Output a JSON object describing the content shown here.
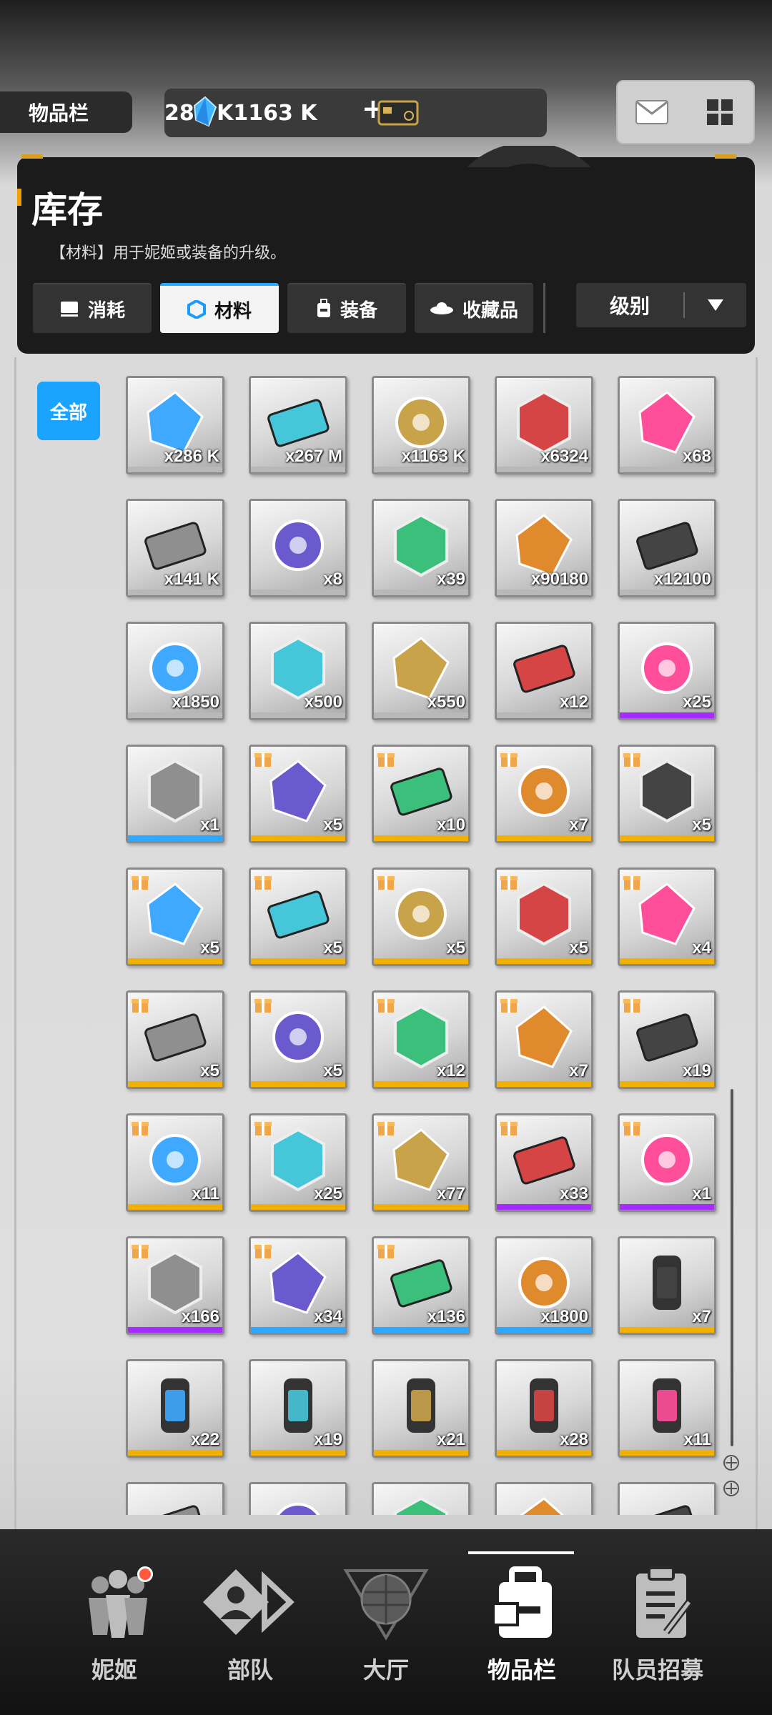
{
  "header": {
    "page_tag": "物品栏",
    "currency": {
      "gems": "286 K",
      "gems_icon": "blue-gem-icon",
      "cards": "1163 K",
      "cards_icon": "credit-card-icon"
    },
    "icons": [
      "mail-icon",
      "grid-menu-icon"
    ]
  },
  "panel": {
    "title": "库存",
    "subtitle": "【材料】用于妮姬或装备的升级。",
    "tabs": [
      {
        "label": "消耗",
        "icon": "consumable-icon"
      },
      {
        "label": "材料",
        "icon": "material-hex-icon",
        "active": true
      },
      {
        "label": "装备",
        "icon": "backpack-icon"
      },
      {
        "label": "收藏品",
        "icon": "ufo-collectible-icon"
      }
    ],
    "sort": {
      "label": "级别"
    }
  },
  "filter": {
    "all_label": "全部"
  },
  "rarity_colors": {
    "gray": "#b8b8b8",
    "blue": "#2ea9ff",
    "purple": "#a42cff",
    "gold": "#f2b000"
  },
  "items": [
    {
      "name": "blue-crystal",
      "count": "x286 K",
      "rarity": "gray",
      "gift": false
    },
    {
      "name": "usb-drive",
      "count": "x267 M",
      "rarity": "gray",
      "gift": false
    },
    {
      "name": "credit-card",
      "count": "x1163 K",
      "rarity": "gray",
      "gift": false
    },
    {
      "name": "core-orb",
      "count": "x6324",
      "rarity": "gray",
      "gift": false
    },
    {
      "name": "pink-heart-gem",
      "count": "x68",
      "rarity": "gray",
      "gift": false
    },
    {
      "name": "hex-ticket",
      "count": "x141 K",
      "rarity": "gray",
      "gift": false
    },
    {
      "name": "idol-card",
      "count": "x8",
      "rarity": "gray",
      "gift": false
    },
    {
      "name": "hologram-card",
      "count": "x39",
      "rarity": "gray",
      "gift": false
    },
    {
      "name": "red-sphere",
      "count": "x90180",
      "rarity": "gray",
      "gift": false
    },
    {
      "name": "dna-hex",
      "count": "x12100",
      "rarity": "gray",
      "gift": false
    },
    {
      "name": "red-emblem-box",
      "count": "x1850",
      "rarity": "gray",
      "gift": false
    },
    {
      "name": "silver-wing-ticket",
      "count": "x500",
      "rarity": "gray",
      "gift": false
    },
    {
      "name": "gold-wing-ticket",
      "count": "x550",
      "rarity": "gray",
      "gift": false
    },
    {
      "name": "id-badge",
      "count": "x12",
      "rarity": "gray",
      "gift": false
    },
    {
      "name": "black-chest-plate",
      "count": "x25",
      "rarity": "purple",
      "gift": false
    },
    {
      "name": "black-module",
      "count": "x1",
      "rarity": "blue",
      "gift": false
    },
    {
      "name": "fox-plush",
      "count": "x5",
      "rarity": "gold",
      "gift": true
    },
    {
      "name": "game-controller",
      "count": "x10",
      "rarity": "gold",
      "gift": true
    },
    {
      "name": "statue",
      "count": "x7",
      "rarity": "gold",
      "gift": true
    },
    {
      "name": "fountain-pen",
      "count": "x5",
      "rarity": "gold",
      "gift": true
    },
    {
      "name": "rabbit-card",
      "count": "x5",
      "rarity": "gold",
      "gift": true
    },
    {
      "name": "pet-food-bowl",
      "count": "x5",
      "rarity": "gold",
      "gift": true
    },
    {
      "name": "towel",
      "count": "x5",
      "rarity": "gold",
      "gift": true
    },
    {
      "name": "starfish-plush",
      "count": "x5",
      "rarity": "gold",
      "gift": true
    },
    {
      "name": "push-remote",
      "count": "x4",
      "rarity": "gold",
      "gift": true
    },
    {
      "name": "toy-train",
      "count": "x5",
      "rarity": "gold",
      "gift": true
    },
    {
      "name": "water-bottles",
      "count": "x5",
      "rarity": "gold",
      "gift": true
    },
    {
      "name": "week-ticket-blue",
      "count": "x12",
      "rarity": "gold",
      "gift": true
    },
    {
      "name": "purple-ticket",
      "count": "x7",
      "rarity": "gold",
      "gift": true
    },
    {
      "name": "vip-ticket",
      "count": "x19",
      "rarity": "gold",
      "gift": true
    },
    {
      "name": "gold-vip-card",
      "count": "x11",
      "rarity": "gold",
      "gift": true
    },
    {
      "name": "red-voucher",
      "count": "x25",
      "rarity": "gold",
      "gift": true
    },
    {
      "name": "green-ticket",
      "count": "x77",
      "rarity": "gold",
      "gift": true
    },
    {
      "name": "week-ticket-green",
      "count": "x33",
      "rarity": "purple",
      "gift": true
    },
    {
      "name": "blue-voucher",
      "count": "x1",
      "rarity": "purple",
      "gift": true
    },
    {
      "name": "pink-ticket",
      "count": "x166",
      "rarity": "purple",
      "gift": true
    },
    {
      "name": "gold-day-ticket",
      "count": "x34",
      "rarity": "blue",
      "gift": true
    },
    {
      "name": "peach-ticket",
      "count": "x136",
      "rarity": "blue",
      "gift": true
    },
    {
      "name": "atom-hex",
      "count": "x1800",
      "rarity": "blue",
      "gift": false
    },
    {
      "name": "blue-battery",
      "count": "x7",
      "rarity": "gold",
      "gift": false
    },
    {
      "name": "green-battery",
      "count": "x22",
      "rarity": "gold",
      "gift": false
    },
    {
      "name": "red-battery",
      "count": "x19",
      "rarity": "gold",
      "gift": false
    },
    {
      "name": "teal-battery",
      "count": "x21",
      "rarity": "gold",
      "gift": false
    },
    {
      "name": "cyan-battery",
      "count": "x28",
      "rarity": "gold",
      "gift": false
    },
    {
      "name": "navy-battery",
      "count": "x11",
      "rarity": "gold",
      "gift": false
    },
    {
      "name": "partial-item-1",
      "count": "",
      "rarity": "gray",
      "gift": false
    },
    {
      "name": "partial-item-2",
      "count": "",
      "rarity": "gray",
      "gift": false
    },
    {
      "name": "partial-item-3",
      "count": "",
      "rarity": "gray",
      "gift": false
    },
    {
      "name": "partial-item-4",
      "count": "",
      "rarity": "gray",
      "gift": false
    },
    {
      "name": "partial-item-5",
      "count": "",
      "rarity": "gray",
      "gift": false
    }
  ],
  "nav": [
    {
      "label": "妮姬",
      "icon": "nikke-icon",
      "badge": true
    },
    {
      "label": "部队",
      "icon": "squad-icon"
    },
    {
      "label": "大厅",
      "icon": "lobby-icon"
    },
    {
      "label": "物品栏",
      "icon": "inventory-icon",
      "active": true
    },
    {
      "label": "队员招募",
      "icon": "recruit-icon"
    }
  ]
}
